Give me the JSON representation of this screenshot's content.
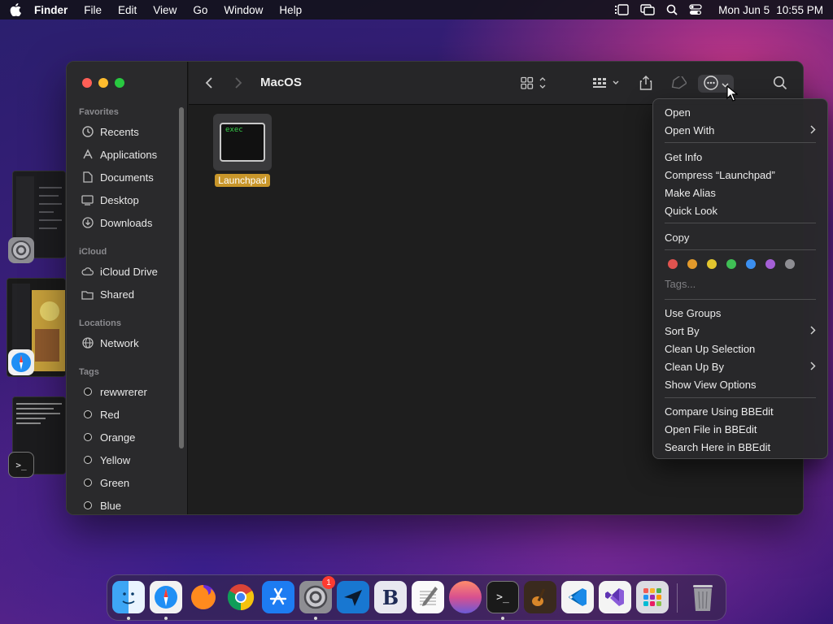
{
  "menubar": {
    "apple": "apple-logo-icon",
    "app": "Finder",
    "items": [
      "File",
      "Edit",
      "View",
      "Go",
      "Window",
      "Help"
    ],
    "date": "Mon Jun 5",
    "time": "10:55 PM"
  },
  "finder": {
    "title": "MacOS",
    "sidebar": {
      "favorites_header": "Favorites",
      "favorites": [
        "Recents",
        "Applications",
        "Documents",
        "Desktop",
        "Downloads"
      ],
      "icloud_header": "iCloud",
      "icloud": [
        "iCloud Drive",
        "Shared"
      ],
      "locations_header": "Locations",
      "locations": [
        "Network"
      ],
      "tags_header": "Tags",
      "tags": [
        "rewwrerer",
        "Red",
        "Orange",
        "Yellow",
        "Green",
        "Blue"
      ]
    },
    "file": {
      "name": "Launchpad",
      "icon_text": "exec"
    }
  },
  "context_menu": {
    "items": [
      {
        "label": "Open"
      },
      {
        "label": "Open With",
        "submenu": true
      },
      {
        "label": "Get Info"
      },
      {
        "label": "Compress “Launchpad”"
      },
      {
        "label": "Make Alias"
      },
      {
        "label": "Quick Look"
      },
      {
        "label": "Copy"
      },
      {
        "label": "Use Groups"
      },
      {
        "label": "Sort By",
        "submenu": true
      },
      {
        "label": "Clean Up Selection"
      },
      {
        "label": "Clean Up By",
        "submenu": true
      },
      {
        "label": "Show View Options"
      },
      {
        "label": "Compare Using BBEdit"
      },
      {
        "label": "Open File in BBEdit"
      },
      {
        "label": "Search Here in BBEdit"
      }
    ],
    "tag_colors": [
      "#e0534f",
      "#e39a2b",
      "#e3c62e",
      "#3fbf55",
      "#3b8ff0",
      "#a560d6",
      "#8e8e93"
    ],
    "tags_placeholder": "Tags..."
  },
  "dock": {
    "apps": [
      "finder-icon",
      "safari-icon",
      "firefox-icon",
      "chrome-icon",
      "app-store-icon",
      "system-settings-icon",
      "copilot-icon",
      "bbedit-icon",
      "textedit-icon",
      "wallpaper-icon",
      "terminal-icon",
      "garageband-icon",
      "vscode-icon",
      "visual-studio-icon",
      "launchpad-icon",
      "trash-icon"
    ],
    "settings_badge": "1"
  }
}
